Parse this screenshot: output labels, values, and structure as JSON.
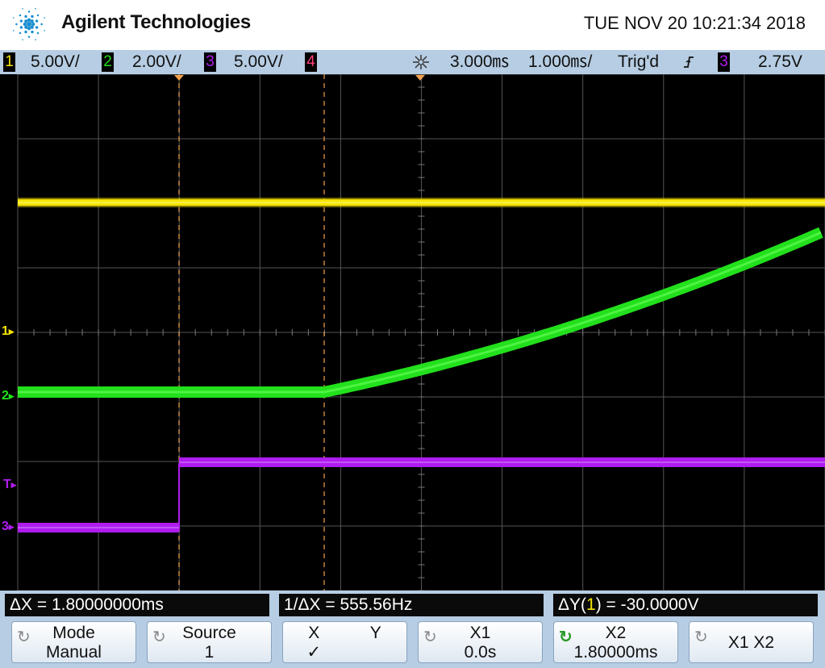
{
  "header": {
    "brand": "Agilent Technologies",
    "datetime": "TUE NOV 20 10:21:34 2018",
    "logo_icon": "agilent-spark-logo"
  },
  "status": {
    "ch1": {
      "num": "1",
      "scale": "5.00V/",
      "color": "#f5e400"
    },
    "ch2": {
      "num": "2",
      "scale": "2.00V/",
      "color": "#22e01c"
    },
    "ch3": {
      "num": "3",
      "scale": "5.00V/",
      "color": "#b01cf0"
    },
    "ch4": {
      "num": "4",
      "color": "#ff3c78"
    },
    "acq_icon": "acquire-burst-icon",
    "delay": "3.000㎳",
    "timebase": "1.000㎳/",
    "trig_state": "Trig'd",
    "trig_edge_icon": "rising-edge-icon",
    "trig_source": "3",
    "trig_level": "2.75V"
  },
  "markers": {
    "ch1": "1",
    "ch2": "2",
    "ch3": "3",
    "trigger": "T"
  },
  "measurements": {
    "dx": "ΔX = 1.80000000ms",
    "inv_dx": "1/ΔX = 555.56Hz",
    "dy_prefix": "ΔY(",
    "dy_channel": "1",
    "dy_suffix": ") = -30.0000V"
  },
  "softkeys": {
    "mode": {
      "label": "Mode",
      "value": "Manual"
    },
    "source": {
      "label": "Source",
      "value": "1"
    },
    "xy": {
      "x": "X",
      "y": "Y",
      "check": "✓"
    },
    "x1": {
      "label": "X1",
      "value": "0.0s"
    },
    "x2": {
      "label": "X2",
      "value": "1.80000ms"
    },
    "x1x2": {
      "label": "X1 X2"
    }
  },
  "colors": {
    "grid": "#6a6a6a",
    "cursor": "#f0a050",
    "ch1": "#f5e400",
    "ch2": "#22e01c",
    "ch3": "#b01cf0"
  },
  "cursors": {
    "x1_time_ms": 0.0,
    "x2_time_ms": 1.8
  }
}
